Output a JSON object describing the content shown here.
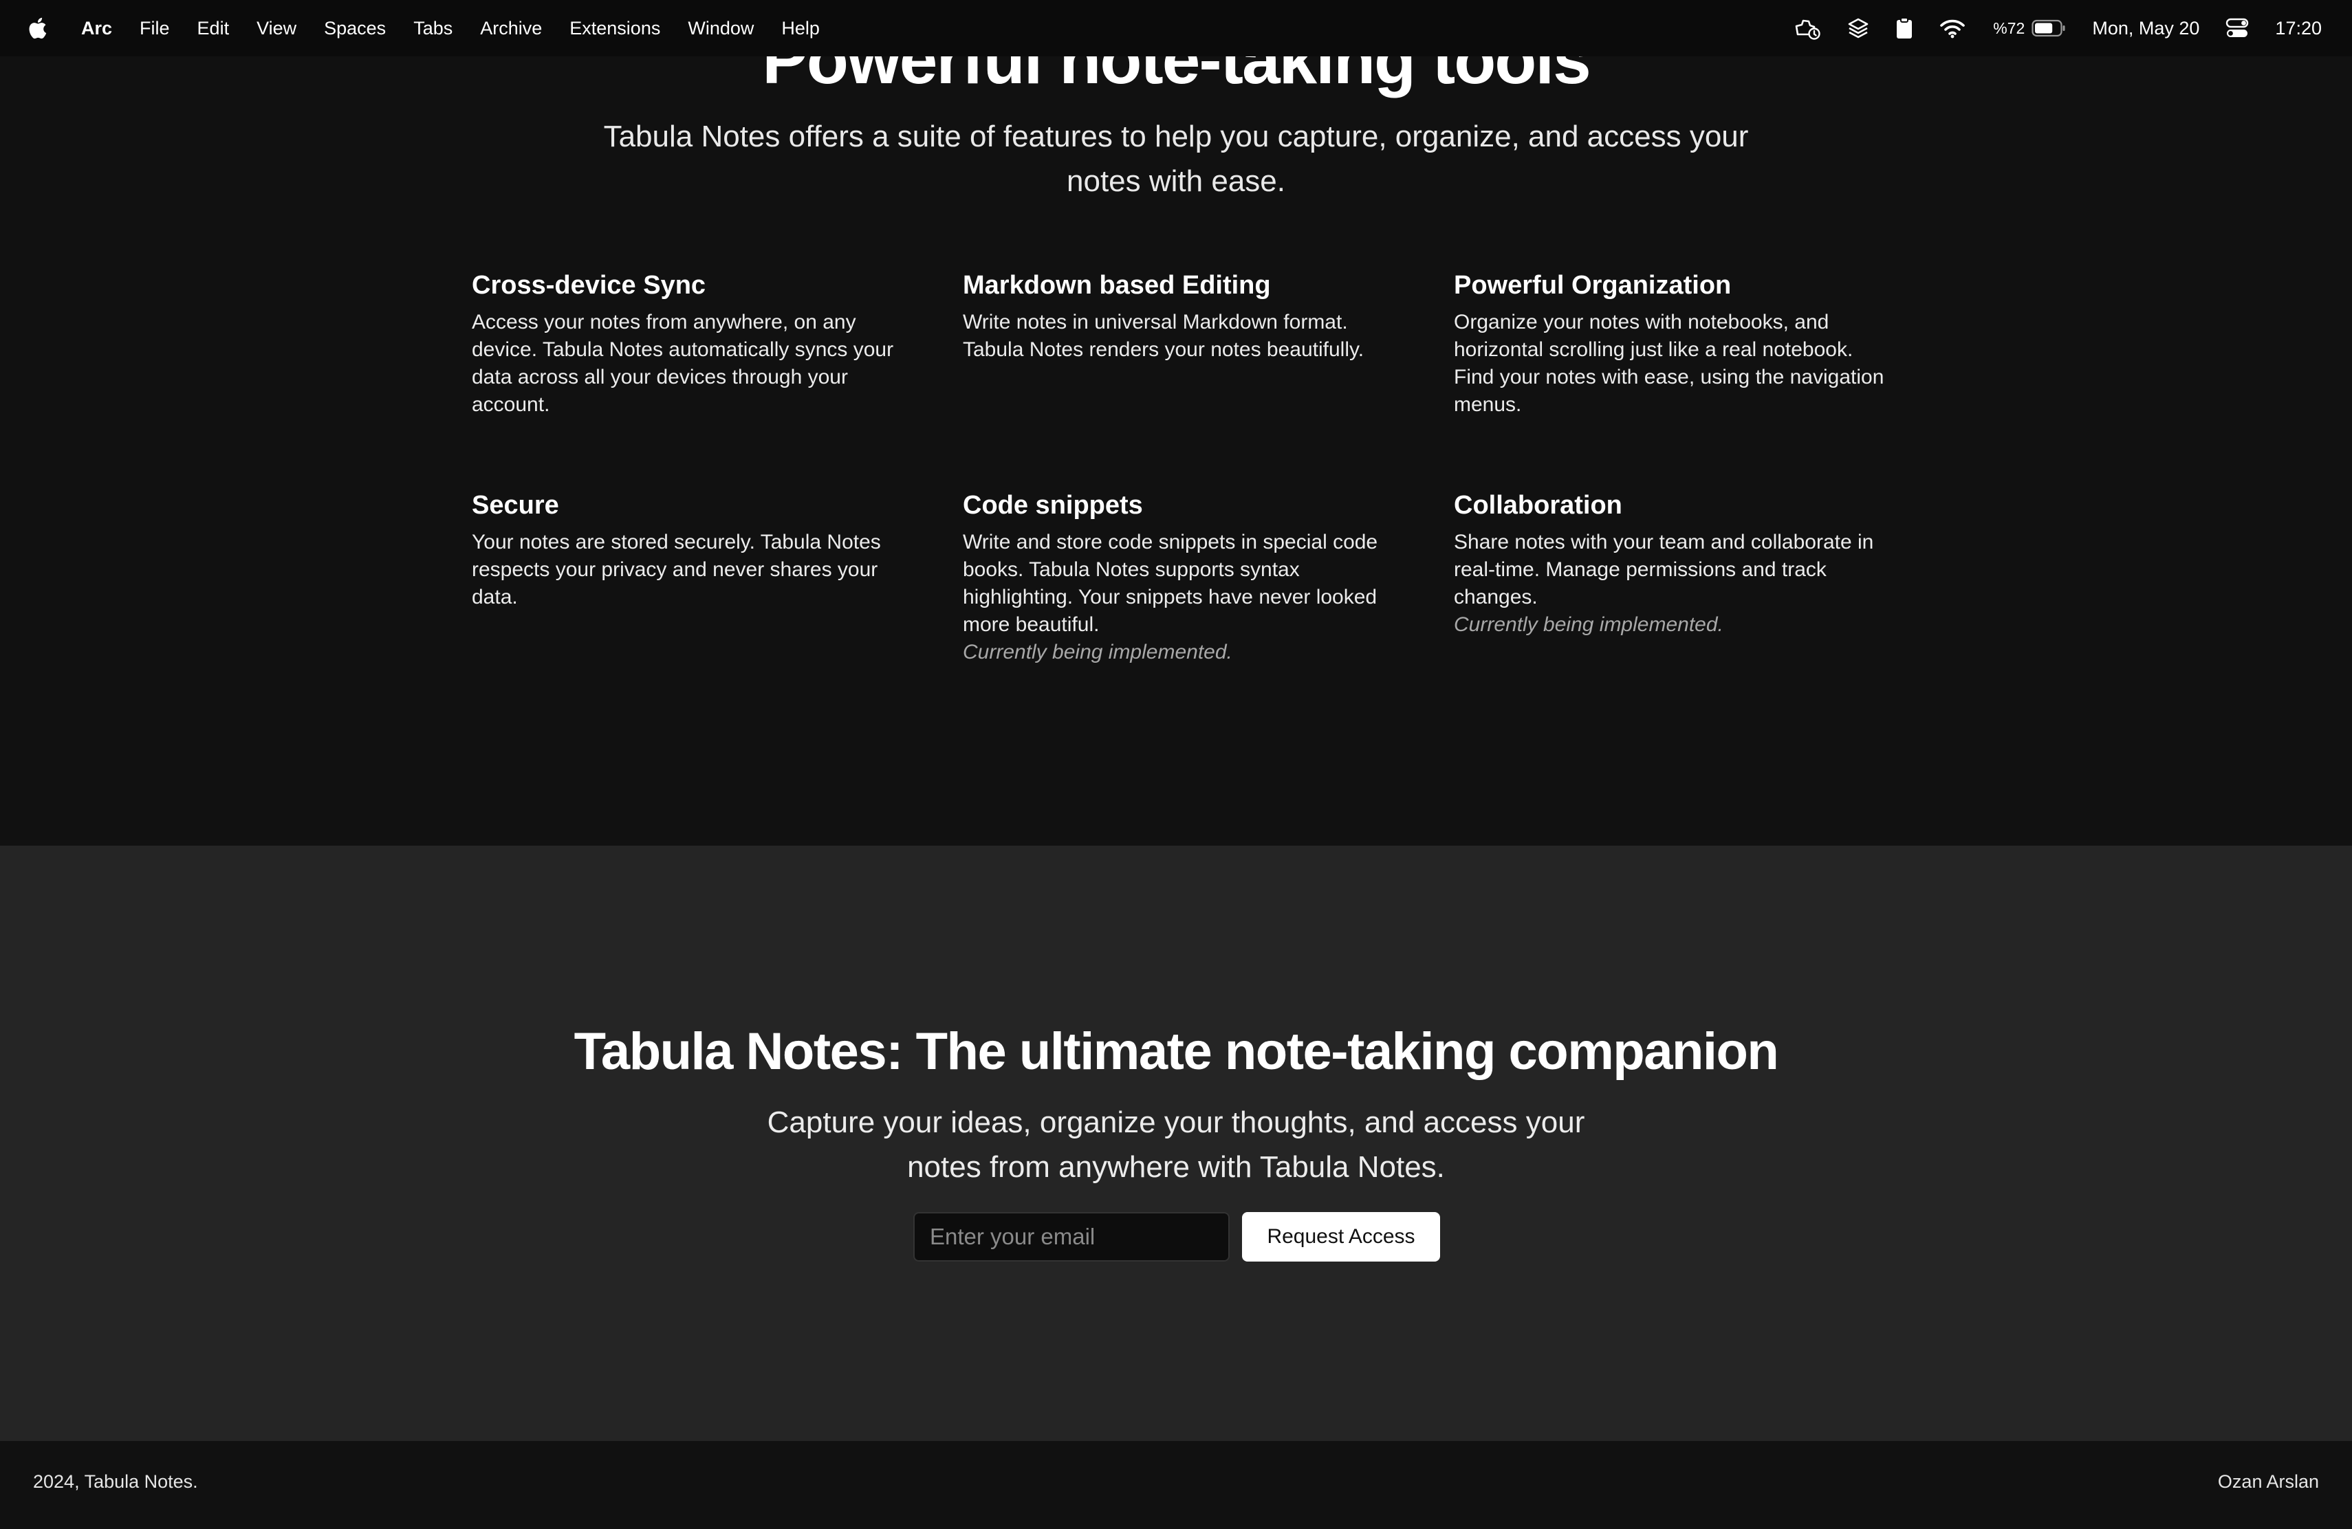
{
  "menubar": {
    "app_name": "Arc",
    "items": [
      "File",
      "Edit",
      "View",
      "Spaces",
      "Tabs",
      "Archive",
      "Extensions",
      "Window",
      "Help"
    ],
    "battery_percent": "%72",
    "date": "Mon, May 20",
    "time": "17:20",
    "battery_level": 0.72,
    "icons": [
      "apple-logo-icon",
      "focus-icon",
      "layers-icon",
      "clipboard-icon",
      "wifi-icon",
      "battery-icon",
      "control-center-icon"
    ]
  },
  "features": {
    "title": "Powerful note-taking tools",
    "subtitle": "Tabula Notes offers a suite of features to help you capture, organize, and access your notes with ease.",
    "items": [
      {
        "title": "Cross-device Sync",
        "description": "Access your notes from anywhere, on any device. Tabula Notes automatically syncs your data across all your devices through your account.",
        "note": ""
      },
      {
        "title": "Markdown based Editing",
        "description": "Write notes in universal Markdown format. Tabula Notes renders your notes beautifully.",
        "note": ""
      },
      {
        "title": "Powerful Organization",
        "description": "Organize your notes with notebooks, and horizontal scrolling just like a real notebook. Find your notes with ease, using the navigation menus.",
        "note": ""
      },
      {
        "title": "Secure",
        "description": "Your notes are stored securely. Tabula Notes respects your privacy and never shares your data.",
        "note": ""
      },
      {
        "title": "Code snippets",
        "description": "Write and store code snippets in special code books. Tabula Notes supports syntax highlighting. Your snippets have never looked more beautiful.",
        "note": "Currently being implemented."
      },
      {
        "title": "Collaboration",
        "description": "Share notes with your team and collaborate in real-time. Manage permissions and track changes.",
        "note": "Currently being implemented."
      }
    ]
  },
  "cta": {
    "title": "Tabula Notes: The ultimate note-taking companion",
    "subtitle": "Capture your ideas, organize your thoughts, and access your notes from anywhere with Tabula Notes.",
    "email_placeholder": "Enter your email",
    "email_value": "",
    "button_label": "Request Access"
  },
  "footer": {
    "copyright": "2024, Tabula Notes.",
    "author": "Ozan Arslan"
  }
}
